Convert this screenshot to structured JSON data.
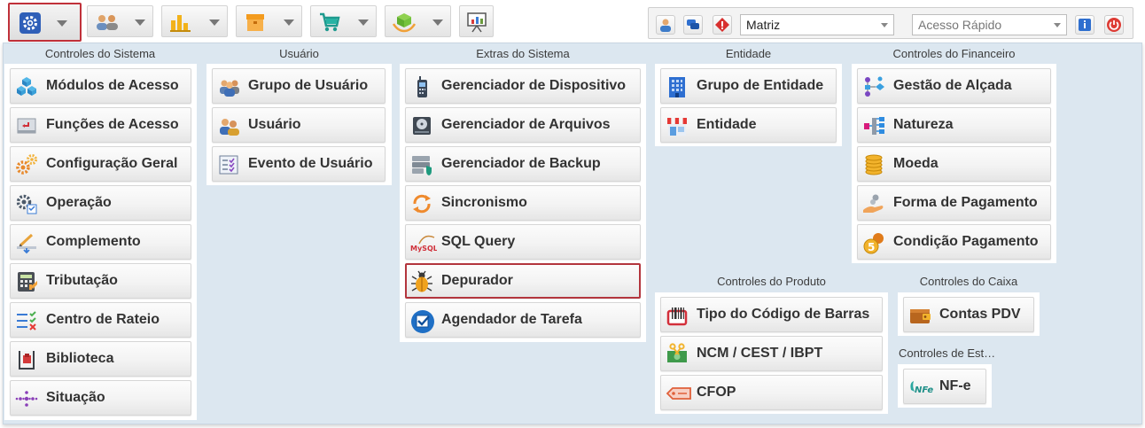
{
  "toolbar": {
    "buttons": [
      {
        "icon": "gear-icon",
        "active": true
      },
      {
        "icon": "users-icon"
      },
      {
        "icon": "bar-chart-icon"
      },
      {
        "icon": "box-icon"
      },
      {
        "icon": "shopping-cart-icon"
      },
      {
        "icon": "hand-box-icon"
      },
      {
        "icon": "presentation-icon"
      }
    ]
  },
  "header_right": {
    "company_select": {
      "value": "Matriz"
    },
    "quick_access": {
      "placeholder": "Acesso Rápido"
    }
  },
  "groups": {
    "sistema": {
      "title": "Controles do Sistema",
      "items": [
        "Módulos de Acesso",
        "Funções de Acesso",
        "Configuração Geral",
        "Operação",
        "Complemento",
        "Tributação",
        "Centro de Rateio",
        "Biblioteca",
        "Situação"
      ]
    },
    "usuario": {
      "title": "Usuário",
      "items": [
        "Grupo de Usuário",
        "Usuário",
        "Evento de Usuário"
      ]
    },
    "extras": {
      "title": "Extras do Sistema",
      "items": [
        "Gerenciador de Dispositivo",
        "Gerenciador de Arquivos",
        "Gerenciador de Backup",
        "Sincronismo",
        "SQL Query",
        "Depurador",
        "Agendador de Tarefa"
      ]
    },
    "entidade": {
      "title": "Entidade",
      "items": [
        "Grupo de Entidade",
        "Entidade"
      ]
    },
    "financeiro": {
      "title": "Controles do Financeiro",
      "items": [
        "Gestão de Alçada",
        "Natureza",
        "Moeda",
        "Forma de Pagamento",
        "Condição Pagamento"
      ]
    },
    "produto": {
      "title": "Controles do Produto",
      "items": [
        "Tipo do Código de Barras",
        "NCM / CEST / IBPT",
        "CFOP"
      ]
    },
    "caixa": {
      "title": "Controles do Caixa",
      "items": [
        "Contas PDV"
      ]
    },
    "estoque": {
      "title": "Controles de Est…",
      "items": [
        "NF-e"
      ]
    }
  },
  "colors": {
    "panel_bg": "#dce7f0",
    "highlight_border": "#b3353d",
    "accent_blue": "#2a6fc9"
  }
}
